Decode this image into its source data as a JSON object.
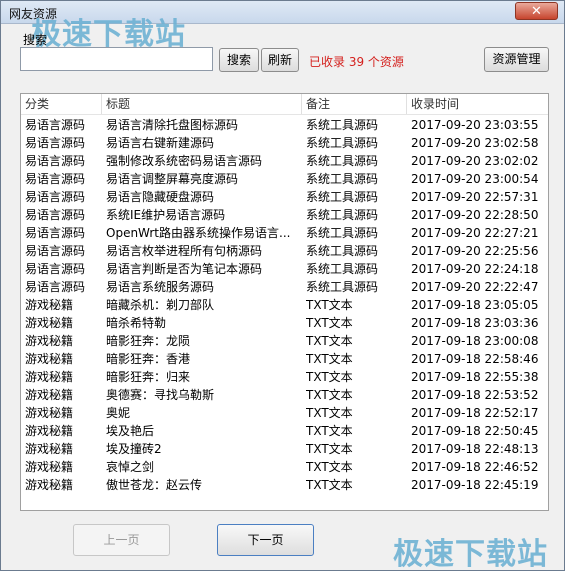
{
  "window": {
    "title": "网友资源",
    "close_label": "✕"
  },
  "watermark": {
    "text": "极速下载站"
  },
  "search": {
    "label": "搜索",
    "placeholder": "",
    "button_label": "搜索",
    "refresh_label": "刷新",
    "count_text": "已收录 39 个资源",
    "manage_label": "资源管理"
  },
  "table": {
    "columns": [
      "分类",
      "标题",
      "备注",
      "收录时间"
    ],
    "rows": [
      [
        "易语言源码",
        "易语言清除托盘图标源码",
        "系统工具源码",
        "2017-09-20 23:03:55"
      ],
      [
        "易语言源码",
        "易语言右键新建源码",
        "系统工具源码",
        "2017-09-20 23:02:58"
      ],
      [
        "易语言源码",
        "强制修改系统密码易语言源码",
        "系统工具源码",
        "2017-09-20 23:02:02"
      ],
      [
        "易语言源码",
        "易语言调整屏幕亮度源码",
        "系统工具源码",
        "2017-09-20 23:00:54"
      ],
      [
        "易语言源码",
        "易语言隐藏硬盘源码",
        "系统工具源码",
        "2017-09-20 22:57:31"
      ],
      [
        "易语言源码",
        "系统IE维护易语言源码",
        "系统工具源码",
        "2017-09-20 22:28:50"
      ],
      [
        "易语言源码",
        "OpenWrt路由器系统操作易语言...",
        "系统工具源码",
        "2017-09-20 22:27:21"
      ],
      [
        "易语言源码",
        "易语言枚举进程所有句柄源码",
        "系统工具源码",
        "2017-09-20 22:25:56"
      ],
      [
        "易语言源码",
        "易语言判断是否为笔记本源码",
        "系统工具源码",
        "2017-09-20 22:24:18"
      ],
      [
        "易语言源码",
        "易语言系统服务源码",
        "系统工具源码",
        "2017-09-20 22:22:47"
      ],
      [
        "游戏秘籍",
        "暗藏杀机：剃刀部队",
        "TXT文本",
        "2017-09-18 23:05:05"
      ],
      [
        "游戏秘籍",
        "暗杀希特勒",
        "TXT文本",
        "2017-09-18 23:03:36"
      ],
      [
        "游戏秘籍",
        "暗影狂奔：龙陨",
        "TXT文本",
        "2017-09-18 23:00:08"
      ],
      [
        "游戏秘籍",
        "暗影狂奔：香港",
        "TXT文本",
        "2017-09-18 22:58:46"
      ],
      [
        "游戏秘籍",
        "暗影狂奔：归来",
        "TXT文本",
        "2017-09-18 22:55:38"
      ],
      [
        "游戏秘籍",
        "奥德赛：寻找乌勒斯",
        "TXT文本",
        "2017-09-18 22:53:52"
      ],
      [
        "游戏秘籍",
        "奥妮",
        "TXT文本",
        "2017-09-18 22:52:17"
      ],
      [
        "游戏秘籍",
        "埃及艳后",
        "TXT文本",
        "2017-09-18 22:50:45"
      ],
      [
        "游戏秘籍",
        "埃及撞砖2",
        "TXT文本",
        "2017-09-18 22:48:13"
      ],
      [
        "游戏秘籍",
        "哀悼之剑",
        "TXT文本",
        "2017-09-18 22:46:52"
      ],
      [
        "游戏秘籍",
        "傲世苍龙：赵云传",
        "TXT文本",
        "2017-09-18 22:45:19"
      ]
    ]
  },
  "pager": {
    "prev_label": "上一页",
    "next_label": "下一页"
  }
}
